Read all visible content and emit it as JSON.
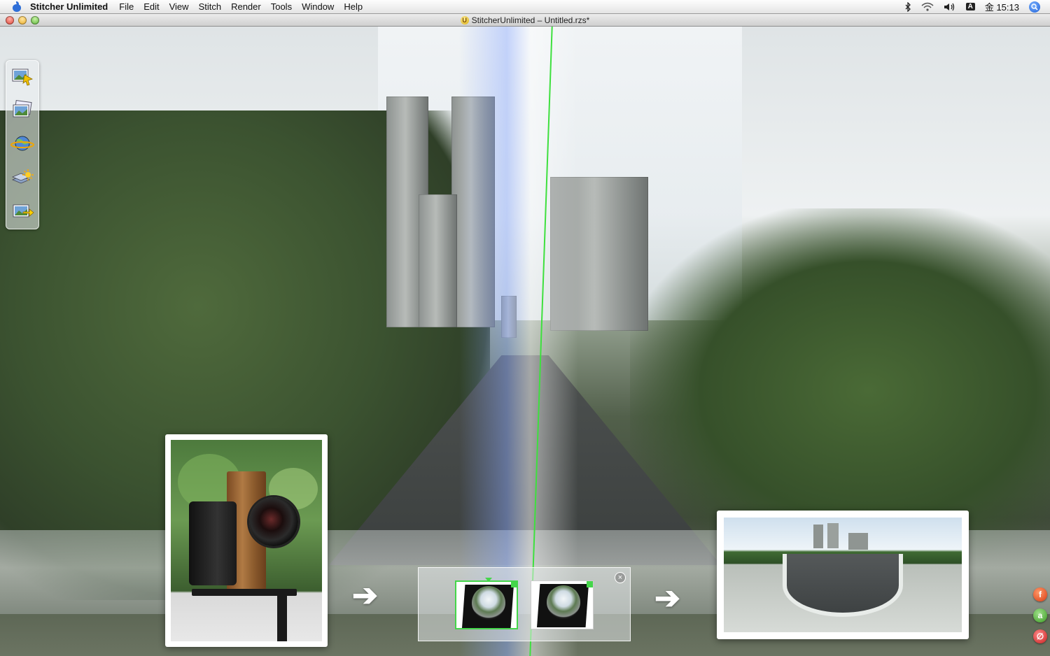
{
  "menubar": {
    "app_name": "Stitcher Unlimited",
    "items": [
      "File",
      "Edit",
      "View",
      "Stitch",
      "Render",
      "Tools",
      "Window",
      "Help"
    ],
    "status": {
      "bluetooth_icon": "bluetooth-icon",
      "wifi_icon": "wifi-icon",
      "volume_icon": "volume-icon",
      "input_icon": "A",
      "clock": "金 15:13",
      "spotlight_icon": "spotlight-icon"
    }
  },
  "window": {
    "title": "StitcherUnlimited – Untitled.rzs*"
  },
  "tool_palette": {
    "tools": [
      "import-images-tool",
      "images-tool",
      "panorama-globe-tool",
      "layers-tool",
      "render-tool"
    ]
  },
  "workflow": {
    "thumbnails": [
      "fisheye-thumbnail-1",
      "fisheye-thumbnail-2"
    ],
    "close_glyph": "×"
  },
  "badges": {
    "flash_glyph": "f",
    "a_glyph": "a",
    "unplug_glyph": "∅"
  },
  "colors": {
    "seam_green": "#3ee03e",
    "thumbnail_selected": "#44d64a"
  }
}
